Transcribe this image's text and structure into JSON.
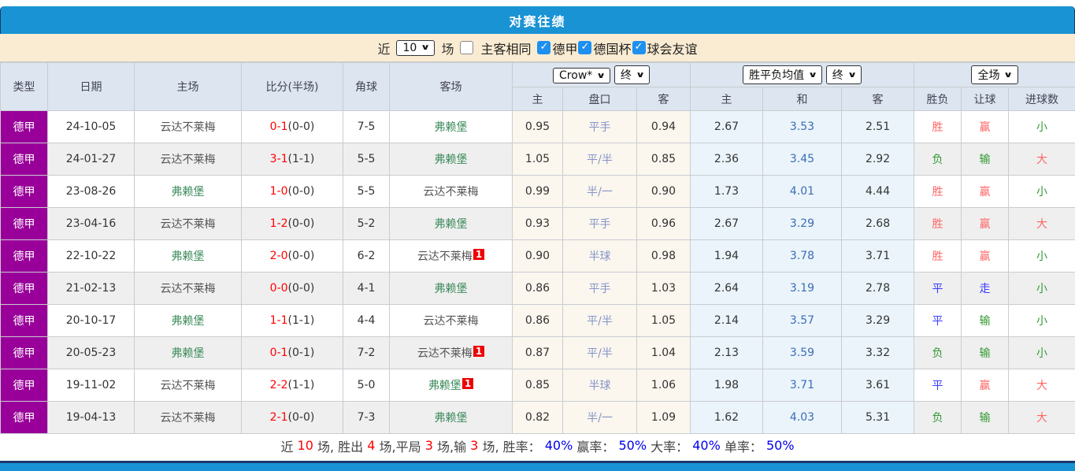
{
  "title": "对赛往绩",
  "filter": {
    "near_label": "近",
    "count_value": "10",
    "games_label": "场",
    "same_venue_label": "主客相同",
    "same_venue_checked": false,
    "leagues": [
      {
        "label": "德甲",
        "checked": true
      },
      {
        "label": "德国杯",
        "checked": true
      },
      {
        "label": "球会友谊",
        "checked": true
      }
    ]
  },
  "table": {
    "headers": {
      "type": "类型",
      "date": "日期",
      "home": "主场",
      "score": "比分(半场)",
      "corner": "角球",
      "away": "客场",
      "odds_select": "Crow*",
      "odds_state_select": "终",
      "odds_sub": [
        "主",
        "盘口",
        "客"
      ],
      "avg_select": "胜平负均值",
      "avg_state_select": "终",
      "avg_sub": [
        "主",
        "和",
        "客"
      ],
      "scope_select": "全场",
      "result_sub": [
        "胜负",
        "让球",
        "进球数"
      ]
    },
    "rows": [
      {
        "league": "德甲",
        "date": "24-10-05",
        "home": "云达不莱梅",
        "home_color": "gray",
        "home_badge": "",
        "score": "0-1",
        "half": "(0-0)",
        "corner": "7-5",
        "away": "弗赖堡",
        "away_color": "green",
        "away_badge": "",
        "odds": [
          "0.95",
          "平手",
          "0.94"
        ],
        "avg": [
          "2.67",
          "3.53",
          "2.51"
        ],
        "results": [
          {
            "t": "胜",
            "c": "red"
          },
          {
            "t": "赢",
            "c": "red"
          },
          {
            "t": "小",
            "c": "green"
          }
        ]
      },
      {
        "league": "德甲",
        "date": "24-01-27",
        "home": "云达不莱梅",
        "home_color": "gray",
        "home_badge": "",
        "score": "3-1",
        "half": "(1-1)",
        "corner": "5-5",
        "away": "弗赖堡",
        "away_color": "green",
        "away_badge": "",
        "odds": [
          "1.05",
          "平/半",
          "0.85"
        ],
        "avg": [
          "2.36",
          "3.45",
          "2.92"
        ],
        "results": [
          {
            "t": "负",
            "c": "green"
          },
          {
            "t": "输",
            "c": "green"
          },
          {
            "t": "大",
            "c": "red"
          }
        ]
      },
      {
        "league": "德甲",
        "date": "23-08-26",
        "home": "弗赖堡",
        "home_color": "green",
        "home_badge": "",
        "score": "1-0",
        "half": "(0-0)",
        "corner": "5-5",
        "away": "云达不莱梅",
        "away_color": "gray",
        "away_badge": "",
        "odds": [
          "0.99",
          "半/一",
          "0.90"
        ],
        "avg": [
          "1.73",
          "4.01",
          "4.44"
        ],
        "results": [
          {
            "t": "胜",
            "c": "red"
          },
          {
            "t": "赢",
            "c": "red"
          },
          {
            "t": "小",
            "c": "green"
          }
        ]
      },
      {
        "league": "德甲",
        "date": "23-04-16",
        "home": "云达不莱梅",
        "home_color": "gray",
        "home_badge": "",
        "score": "1-2",
        "half": "(0-0)",
        "corner": "5-2",
        "away": "弗赖堡",
        "away_color": "green",
        "away_badge": "",
        "odds": [
          "0.93",
          "平手",
          "0.96"
        ],
        "avg": [
          "2.67",
          "3.29",
          "2.68"
        ],
        "results": [
          {
            "t": "胜",
            "c": "red"
          },
          {
            "t": "赢",
            "c": "red"
          },
          {
            "t": "大",
            "c": "red"
          }
        ]
      },
      {
        "league": "德甲",
        "date": "22-10-22",
        "home": "弗赖堡",
        "home_color": "green",
        "home_badge": "",
        "score": "2-0",
        "half": "(0-0)",
        "corner": "6-2",
        "away": "云达不莱梅",
        "away_color": "gray",
        "away_badge": "1",
        "odds": [
          "0.90",
          "半球",
          "0.98"
        ],
        "avg": [
          "1.94",
          "3.78",
          "3.71"
        ],
        "results": [
          {
            "t": "胜",
            "c": "red"
          },
          {
            "t": "赢",
            "c": "red"
          },
          {
            "t": "小",
            "c": "green"
          }
        ]
      },
      {
        "league": "德甲",
        "date": "21-02-13",
        "home": "云达不莱梅",
        "home_color": "gray",
        "home_badge": "",
        "score": "0-0",
        "half": "(0-0)",
        "corner": "4-1",
        "away": "弗赖堡",
        "away_color": "green",
        "away_badge": "",
        "odds": [
          "0.86",
          "平手",
          "1.03"
        ],
        "avg": [
          "2.64",
          "3.19",
          "2.78"
        ],
        "results": [
          {
            "t": "平",
            "c": "blue"
          },
          {
            "t": "走",
            "c": "blue"
          },
          {
            "t": "小",
            "c": "green"
          }
        ]
      },
      {
        "league": "德甲",
        "date": "20-10-17",
        "home": "弗赖堡",
        "home_color": "green",
        "home_badge": "",
        "score": "1-1",
        "half": "(1-1)",
        "corner": "4-4",
        "away": "云达不莱梅",
        "away_color": "gray",
        "away_badge": "",
        "odds": [
          "0.86",
          "平/半",
          "1.05"
        ],
        "avg": [
          "2.14",
          "3.57",
          "3.29"
        ],
        "results": [
          {
            "t": "平",
            "c": "blue"
          },
          {
            "t": "输",
            "c": "green"
          },
          {
            "t": "小",
            "c": "green"
          }
        ]
      },
      {
        "league": "德甲",
        "date": "20-05-23",
        "home": "弗赖堡",
        "home_color": "green",
        "home_badge": "",
        "score": "0-1",
        "half": "(0-1)",
        "corner": "7-2",
        "away": "云达不莱梅",
        "away_color": "gray",
        "away_badge": "1",
        "odds": [
          "0.87",
          "平/半",
          "1.04"
        ],
        "avg": [
          "2.13",
          "3.59",
          "3.32"
        ],
        "results": [
          {
            "t": "负",
            "c": "green"
          },
          {
            "t": "输",
            "c": "green"
          },
          {
            "t": "小",
            "c": "green"
          }
        ]
      },
      {
        "league": "德甲",
        "date": "19-11-02",
        "home": "云达不莱梅",
        "home_color": "gray",
        "home_badge": "",
        "score": "2-2",
        "half": "(1-1)",
        "corner": "5-0",
        "away": "弗赖堡",
        "away_color": "green",
        "away_badge": "1",
        "odds": [
          "0.85",
          "半球",
          "1.06"
        ],
        "avg": [
          "1.98",
          "3.71",
          "3.61"
        ],
        "results": [
          {
            "t": "平",
            "c": "blue"
          },
          {
            "t": "赢",
            "c": "red"
          },
          {
            "t": "大",
            "c": "red"
          }
        ]
      },
      {
        "league": "德甲",
        "date": "19-04-13",
        "home": "云达不莱梅",
        "home_color": "gray",
        "home_badge": "",
        "score": "2-1",
        "half": "(0-0)",
        "corner": "7-3",
        "away": "弗赖堡",
        "away_color": "green",
        "away_badge": "",
        "odds": [
          "0.82",
          "半/一",
          "1.09"
        ],
        "avg": [
          "1.62",
          "4.03",
          "5.31"
        ],
        "results": [
          {
            "t": "负",
            "c": "green"
          },
          {
            "t": "输",
            "c": "green"
          },
          {
            "t": "大",
            "c": "red"
          }
        ]
      }
    ]
  },
  "footer_segments": [
    {
      "t": "近 ",
      "c": "dark"
    },
    {
      "t": "10",
      "c": "red"
    },
    {
      "t": " 场, 胜出 ",
      "c": "dark"
    },
    {
      "t": "4",
      "c": "red"
    },
    {
      "t": " 场,平局 ",
      "c": "dark"
    },
    {
      "t": "3",
      "c": "red"
    },
    {
      "t": " 场,输 ",
      "c": "dark"
    },
    {
      "t": "3",
      "c": "red"
    },
    {
      "t": " 场, 胜率： ",
      "c": "dark"
    },
    {
      "t": "40%",
      "c": "blue"
    },
    {
      "t": " 赢率： ",
      "c": "dark"
    },
    {
      "t": "50%",
      "c": "blue"
    },
    {
      "t": " 大率： ",
      "c": "dark"
    },
    {
      "t": "40%",
      "c": "blue"
    },
    {
      "t": " 单率： ",
      "c": "dark"
    },
    {
      "t": "50%",
      "c": "blue"
    }
  ]
}
